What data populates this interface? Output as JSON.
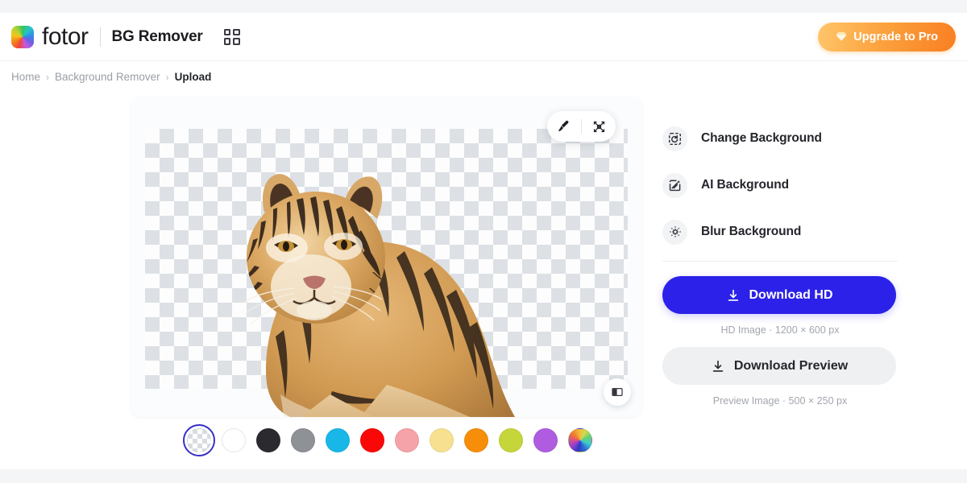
{
  "header": {
    "logo_text": "fotor",
    "logo_icon": "color-wheel-icon",
    "app_title": "BG Remover",
    "apps_icon": "grid-apps-icon",
    "upgrade_label": "Upgrade to Pro",
    "upgrade_icon": "gem-icon",
    "upgrade_gradient_from": "#ffc66b",
    "upgrade_gradient_to": "#f97f22"
  },
  "breadcrumb": {
    "items": [
      {
        "label": "Home",
        "current": false
      },
      {
        "label": "Background Remover",
        "current": false
      },
      {
        "label": "Upload",
        "current": true
      }
    ],
    "separator": "›"
  },
  "canvas": {
    "tools": [
      {
        "name": "brush-tool",
        "icon": "brush-icon"
      },
      {
        "name": "erase-restore-tool",
        "icon": "magic-eraser-icon"
      }
    ],
    "compare_icon": "before-after-compare-icon",
    "background": "transparent-checkerboard",
    "subject": "tiger-cub-cutout"
  },
  "swatches": {
    "selected_index": 0,
    "ring_color": "#3730c8",
    "items": [
      {
        "name": "transparent",
        "color": "transparent",
        "type": "checker"
      },
      {
        "name": "white",
        "color": "#ffffff",
        "type": "solid"
      },
      {
        "name": "black",
        "color": "#2b2b2f",
        "type": "solid"
      },
      {
        "name": "gray",
        "color": "#8e9196",
        "type": "solid"
      },
      {
        "name": "cyan",
        "color": "#19b7e8",
        "type": "solid"
      },
      {
        "name": "red",
        "color": "#fa0808",
        "type": "solid"
      },
      {
        "name": "pink",
        "color": "#f5a3a8",
        "type": "solid"
      },
      {
        "name": "light-yellow",
        "color": "#f7e08f",
        "type": "solid"
      },
      {
        "name": "orange",
        "color": "#f78e0a",
        "type": "solid"
      },
      {
        "name": "yellow-green",
        "color": "#c4d63a",
        "type": "solid"
      },
      {
        "name": "purple",
        "color": "#b05ce0",
        "type": "solid"
      },
      {
        "name": "custom-picker",
        "color": "rainbow",
        "type": "wheel"
      }
    ]
  },
  "panel": {
    "options": [
      {
        "label": "Change Background",
        "icon": "change-background-icon"
      },
      {
        "label": "AI Background",
        "icon": "ai-background-icon"
      },
      {
        "label": "Blur Background",
        "icon": "blur-background-icon"
      }
    ],
    "download_hd": {
      "label": "Download HD",
      "icon": "download-icon",
      "note": "HD Image · 1200 × 600 px",
      "color": "#2b21e8"
    },
    "download_preview": {
      "label": "Download Preview",
      "icon": "download-icon",
      "note": "Preview Image · 500 × 250 px",
      "color": "#eef0f2"
    }
  }
}
